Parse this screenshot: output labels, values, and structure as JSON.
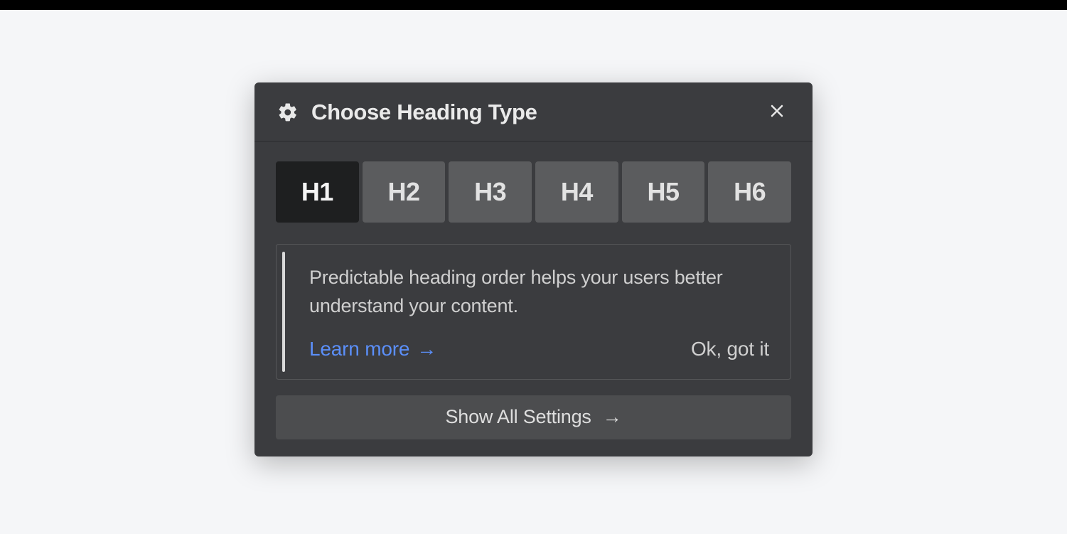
{
  "panel": {
    "title": "Choose Heading Type",
    "headings": [
      "H1",
      "H2",
      "H3",
      "H4",
      "H5",
      "H6"
    ],
    "active_heading_index": 0,
    "notice": {
      "text": "Predictable heading order helps your users better understand your content.",
      "learn_more_label": "Learn more",
      "dismiss_label": "Ok, got it"
    },
    "show_all_label": "Show All Settings"
  },
  "colors": {
    "panel_bg": "#3b3c3f",
    "tab_bg": "#5b5c5e",
    "tab_active_bg": "#1e1f20",
    "link": "#5b8ff9"
  }
}
